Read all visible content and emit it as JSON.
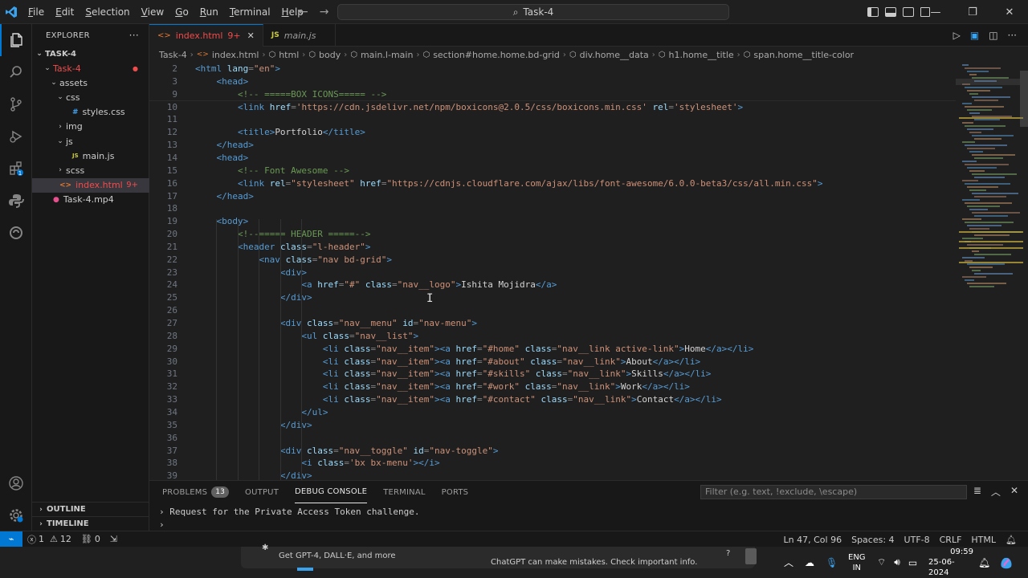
{
  "titlebar": {
    "menus": [
      "File",
      "Edit",
      "Selection",
      "View",
      "Go",
      "Run",
      "Terminal",
      "Help"
    ],
    "search_text": "Task-4"
  },
  "explorer": {
    "title": "EXPLORER",
    "more": "···",
    "root": "TASK-4",
    "items": [
      {
        "label": "Task-4",
        "level": 1,
        "chev": "⌄",
        "type": "folder",
        "decor": "●"
      },
      {
        "label": "assets",
        "level": 2,
        "chev": "⌄",
        "type": "folder"
      },
      {
        "label": "css",
        "level": 3,
        "chev": "⌄",
        "type": "folder"
      },
      {
        "label": "styles.css",
        "level": 4,
        "chev": "",
        "type": "css",
        "icon": "#"
      },
      {
        "label": "img",
        "level": 3,
        "chev": "›",
        "type": "folder"
      },
      {
        "label": "js",
        "level": 3,
        "chev": "⌄",
        "type": "folder"
      },
      {
        "label": "main.js",
        "level": 4,
        "chev": "",
        "type": "js",
        "icon": "JS"
      },
      {
        "label": "scss",
        "level": 3,
        "chev": "›",
        "type": "folder"
      },
      {
        "label": "index.html",
        "level": 2,
        "chev": "",
        "type": "html",
        "icon": "<>",
        "badge": "9+"
      },
      {
        "label": "Task-4.mp4",
        "level": 1,
        "chev": "",
        "type": "video",
        "icon": "●"
      }
    ],
    "outline": "OUTLINE",
    "timeline": "TIMELINE"
  },
  "tabs": [
    {
      "label": "index.html",
      "badge": "9+",
      "icon": "<>",
      "active": true
    },
    {
      "label": "main.js",
      "icon": "JS",
      "active": false
    }
  ],
  "breadcrumbs": [
    "Task-4",
    "index.html",
    "html",
    "body",
    "main.l-main",
    "section#home.home.bd-grid",
    "div.home__data",
    "h1.home__title",
    "span.home__title-color"
  ],
  "code_lines": [
    {
      "n": "2",
      "sticky": true,
      "indent": 0,
      "parts": [
        [
          "tag",
          "<html "
        ],
        [
          "attr",
          "lang"
        ],
        [
          "punct",
          "="
        ],
        [
          "str",
          "\"en\""
        ],
        [
          "tag",
          ">"
        ]
      ]
    },
    {
      "n": "3",
      "sticky": true,
      "indent": 1,
      "parts": [
        [
          "tag",
          "<head>"
        ]
      ]
    },
    {
      "n": "9",
      "sticky": true,
      "indent": 2,
      "parts": [
        [
          "com",
          "<!-- =====BOX ICONS===== -->"
        ]
      ]
    },
    {
      "n": "10",
      "indent": 2,
      "parts": [
        [
          "tag",
          "<link "
        ],
        [
          "attr",
          "href"
        ],
        [
          "punct",
          "="
        ],
        [
          "str",
          "'https://cdn.jsdelivr.net/npm/boxicons@2.0.5/css/boxicons.min.css'"
        ],
        [
          "attr",
          " rel"
        ],
        [
          "punct",
          "="
        ],
        [
          "str",
          "'stylesheet'"
        ],
        [
          "tag",
          ">"
        ]
      ]
    },
    {
      "n": "11",
      "indent": 0,
      "parts": []
    },
    {
      "n": "12",
      "indent": 2,
      "parts": [
        [
          "tag",
          "<title>"
        ],
        [
          "txt",
          "Portfolio"
        ],
        [
          "tag",
          "</title>"
        ]
      ]
    },
    {
      "n": "13",
      "indent": 1,
      "parts": [
        [
          "tag",
          "</head>"
        ]
      ]
    },
    {
      "n": "14",
      "indent": 1,
      "parts": [
        [
          "tag",
          "<head>"
        ]
      ]
    },
    {
      "n": "15",
      "indent": 2,
      "parts": [
        [
          "com",
          "<!-- Font Awesome -->"
        ]
      ]
    },
    {
      "n": "16",
      "indent": 2,
      "parts": [
        [
          "tag",
          "<link "
        ],
        [
          "attr",
          "rel"
        ],
        [
          "punct",
          "="
        ],
        [
          "str",
          "\"stylesheet\""
        ],
        [
          "attr",
          " href"
        ],
        [
          "punct",
          "="
        ],
        [
          "str",
          "\"https://cdnjs.cloudflare.com/ajax/libs/font-awesome/6.0.0-beta3/css/all.min.css\""
        ],
        [
          "tag",
          ">"
        ]
      ]
    },
    {
      "n": "17",
      "indent": 1,
      "parts": [
        [
          "tag",
          "</head>"
        ]
      ]
    },
    {
      "n": "18",
      "indent": 0,
      "parts": []
    },
    {
      "n": "19",
      "indent": 1,
      "parts": [
        [
          "tag",
          "<body>"
        ]
      ]
    },
    {
      "n": "20",
      "indent": 2,
      "parts": [
        [
          "com",
          "<!--===== HEADER =====-->"
        ]
      ]
    },
    {
      "n": "21",
      "indent": 2,
      "parts": [
        [
          "tag",
          "<header "
        ],
        [
          "attr",
          "class"
        ],
        [
          "punct",
          "="
        ],
        [
          "str",
          "\"l-header\""
        ],
        [
          "tag",
          ">"
        ]
      ]
    },
    {
      "n": "22",
      "indent": 3,
      "parts": [
        [
          "tag",
          "<nav "
        ],
        [
          "attr",
          "class"
        ],
        [
          "punct",
          "="
        ],
        [
          "str",
          "\"nav bd-grid\""
        ],
        [
          "tag",
          ">"
        ]
      ]
    },
    {
      "n": "23",
      "indent": 4,
      "parts": [
        [
          "tag",
          "<div>"
        ]
      ]
    },
    {
      "n": "24",
      "indent": 5,
      "parts": [
        [
          "tag",
          "<a "
        ],
        [
          "attr",
          "href"
        ],
        [
          "punct",
          "="
        ],
        [
          "str",
          "\"#\""
        ],
        [
          "attr",
          " class"
        ],
        [
          "punct",
          "="
        ],
        [
          "str",
          "\"nav__logo\""
        ],
        [
          "tag",
          ">"
        ],
        [
          "txt",
          "Ishita Mojidra"
        ],
        [
          "tag",
          "</a>"
        ]
      ]
    },
    {
      "n": "25",
      "indent": 4,
      "parts": [
        [
          "tag",
          "</div>"
        ]
      ]
    },
    {
      "n": "26",
      "indent": 0,
      "parts": []
    },
    {
      "n": "27",
      "indent": 4,
      "parts": [
        [
          "tag",
          "<div "
        ],
        [
          "attr",
          "class"
        ],
        [
          "punct",
          "="
        ],
        [
          "str",
          "\"nav__menu\""
        ],
        [
          "attr",
          " id"
        ],
        [
          "punct",
          "="
        ],
        [
          "str",
          "\"nav-menu\""
        ],
        [
          "tag",
          ">"
        ]
      ]
    },
    {
      "n": "28",
      "indent": 5,
      "parts": [
        [
          "tag",
          "<ul "
        ],
        [
          "attr",
          "class"
        ],
        [
          "punct",
          "="
        ],
        [
          "str",
          "\"nav__list\""
        ],
        [
          "tag",
          ">"
        ]
      ]
    },
    {
      "n": "29",
      "indent": 6,
      "parts": [
        [
          "tag",
          "<li "
        ],
        [
          "attr",
          "class"
        ],
        [
          "punct",
          "="
        ],
        [
          "str",
          "\"nav__item\""
        ],
        [
          "tag",
          "><a "
        ],
        [
          "attr",
          "href"
        ],
        [
          "punct",
          "="
        ],
        [
          "str",
          "\"#home\""
        ],
        [
          "attr",
          " class"
        ],
        [
          "punct",
          "="
        ],
        [
          "str",
          "\"nav__link active-link\""
        ],
        [
          "tag",
          ">"
        ],
        [
          "txt",
          "Home"
        ],
        [
          "tag",
          "</a></li>"
        ]
      ]
    },
    {
      "n": "30",
      "indent": 6,
      "parts": [
        [
          "tag",
          "<li "
        ],
        [
          "attr",
          "class"
        ],
        [
          "punct",
          "="
        ],
        [
          "str",
          "\"nav__item\""
        ],
        [
          "tag",
          "><a "
        ],
        [
          "attr",
          "href"
        ],
        [
          "punct",
          "="
        ],
        [
          "str",
          "\"#about\""
        ],
        [
          "attr",
          " class"
        ],
        [
          "punct",
          "="
        ],
        [
          "str",
          "\"nav__link\""
        ],
        [
          "tag",
          ">"
        ],
        [
          "txt",
          "About"
        ],
        [
          "tag",
          "</a></li>"
        ]
      ]
    },
    {
      "n": "31",
      "indent": 6,
      "parts": [
        [
          "tag",
          "<li "
        ],
        [
          "attr",
          "class"
        ],
        [
          "punct",
          "="
        ],
        [
          "str",
          "\"nav__item\""
        ],
        [
          "tag",
          "><a "
        ],
        [
          "attr",
          "href"
        ],
        [
          "punct",
          "="
        ],
        [
          "str",
          "\"#skills\""
        ],
        [
          "attr",
          " class"
        ],
        [
          "punct",
          "="
        ],
        [
          "str",
          "\"nav__link\""
        ],
        [
          "tag",
          ">"
        ],
        [
          "txt",
          "Skills"
        ],
        [
          "tag",
          "</a></li>"
        ]
      ]
    },
    {
      "n": "32",
      "indent": 6,
      "parts": [
        [
          "tag",
          "<li "
        ],
        [
          "attr",
          "class"
        ],
        [
          "punct",
          "="
        ],
        [
          "str",
          "\"nav__item\""
        ],
        [
          "tag",
          "><a "
        ],
        [
          "attr",
          "href"
        ],
        [
          "punct",
          "="
        ],
        [
          "str",
          "\"#work\""
        ],
        [
          "attr",
          " class"
        ],
        [
          "punct",
          "="
        ],
        [
          "str",
          "\"nav__link\""
        ],
        [
          "tag",
          ">"
        ],
        [
          "txt",
          "Work"
        ],
        [
          "tag",
          "</a></li>"
        ]
      ]
    },
    {
      "n": "33",
      "indent": 6,
      "parts": [
        [
          "tag",
          "<li "
        ],
        [
          "attr",
          "class"
        ],
        [
          "punct",
          "="
        ],
        [
          "str",
          "\"nav__item\""
        ],
        [
          "tag",
          "><a "
        ],
        [
          "attr",
          "href"
        ],
        [
          "punct",
          "="
        ],
        [
          "str",
          "\"#contact\""
        ],
        [
          "attr",
          " class"
        ],
        [
          "punct",
          "="
        ],
        [
          "str",
          "\"nav__link\""
        ],
        [
          "tag",
          ">"
        ],
        [
          "txt",
          "Contact"
        ],
        [
          "tag",
          "</a></li>"
        ]
      ]
    },
    {
      "n": "34",
      "indent": 5,
      "parts": [
        [
          "tag",
          "</ul>"
        ]
      ]
    },
    {
      "n": "35",
      "indent": 4,
      "parts": [
        [
          "tag",
          "</div>"
        ]
      ]
    },
    {
      "n": "36",
      "indent": 0,
      "parts": []
    },
    {
      "n": "37",
      "indent": 4,
      "parts": [
        [
          "tag",
          "<div "
        ],
        [
          "attr",
          "class"
        ],
        [
          "punct",
          "="
        ],
        [
          "str",
          "\"nav__toggle\""
        ],
        [
          "attr",
          " id"
        ],
        [
          "punct",
          "="
        ],
        [
          "str",
          "\"nav-toggle\""
        ],
        [
          "tag",
          ">"
        ]
      ]
    },
    {
      "n": "38",
      "indent": 5,
      "parts": [
        [
          "tag",
          "<i "
        ],
        [
          "attr",
          "class"
        ],
        [
          "punct",
          "="
        ],
        [
          "str",
          "'bx bx-menu'"
        ],
        [
          "tag",
          "></i>"
        ]
      ]
    },
    {
      "n": "39",
      "indent": 4,
      "parts": [
        [
          "tag",
          "</div>"
        ]
      ]
    }
  ],
  "panel": {
    "tabs": [
      {
        "label": "PROBLEMS",
        "badge": "13"
      },
      {
        "label": "OUTPUT"
      },
      {
        "label": "DEBUG CONSOLE",
        "active": true
      },
      {
        "label": "TERMINAL"
      },
      {
        "label": "PORTS"
      }
    ],
    "filter_placeholder": "Filter (e.g. text, !exclude, \\escape)",
    "console_lines": [
      "Request for the Private Access Token challenge."
    ],
    "prompt": "›"
  },
  "statusbar": {
    "remote": "⌁",
    "errors": "1",
    "warnings": "12",
    "ports": "0",
    "position": "Ln 47, Col 96",
    "spaces": "Spaces: 4",
    "encoding": "UTF-8",
    "eol": "CRLF",
    "language": "HTML"
  },
  "taskbar": {
    "chatgpt_left": "Get GPT-4, DALL·E, and more",
    "chatgpt_note": "ChatGPT can make mistakes. Check important info.",
    "chatgpt_help": "?",
    "lang_line1": "ENG",
    "lang_line2": "IN",
    "time": "09:59",
    "date": "25-06-2024"
  },
  "colors": {
    "accent": "#0078d4",
    "modified": "#f14c4c",
    "html_icon": "#e37933",
    "css_icon": "#42a5f5",
    "js_icon": "#cbcb41"
  }
}
